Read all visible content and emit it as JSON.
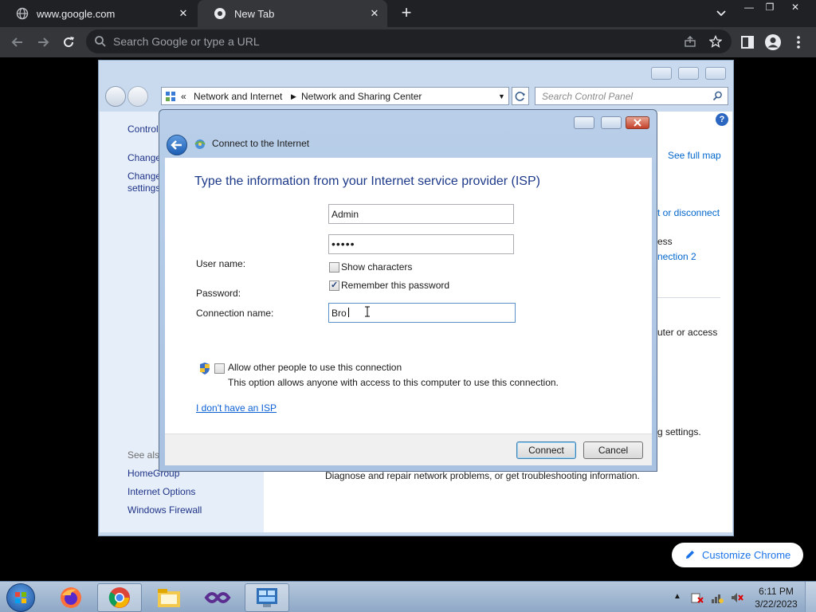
{
  "browser": {
    "tabs": [
      {
        "title": "www.google.com",
        "icon": "globe-icon"
      },
      {
        "title": "New Tab",
        "icon": "chrome-icon"
      }
    ],
    "omnibox_placeholder": "Search Google or type a URL"
  },
  "control_panel": {
    "breadcrumb": [
      "«",
      "Network and Internet",
      "Network and Sharing Center"
    ],
    "search_placeholder": "Search Control Panel",
    "left_links": [
      "Control",
      "Change",
      "Change",
      "settings"
    ],
    "see_also_title": "See also",
    "see_also": [
      "HomeGroup",
      "Internet Options",
      "Windows Firewall"
    ],
    "main_fragments": {
      "see_full_map": "See full map",
      "connect_disconnect": "t or disconnect",
      "access": "ess",
      "connection": "nection 2",
      "router_access": "uter or access",
      "settings": "g settings.",
      "diagnose": "Diagnose and repair network problems, or get troubleshooting information."
    }
  },
  "dialog": {
    "title": "Connect to the Internet",
    "heading": "Type the information from your Internet service provider (ISP)",
    "user_name_label": "User name:",
    "user_name_value": "Admin",
    "password_label": "Password:",
    "password_value": "•••••",
    "show_characters": {
      "label": "Show characters",
      "checked": false
    },
    "remember_password": {
      "label": "Remember this password",
      "checked": true
    },
    "connection_name_label": "Connection name:",
    "connection_name_value": "Bro",
    "allow_others": {
      "label": "Allow other people to use this connection",
      "checked": false
    },
    "allow_others_desc": "This option allows anyone with access to this computer to use this connection.",
    "no_isp_link": "I don't have an ISP",
    "connect_button": "Connect",
    "cancel_button": "Cancel"
  },
  "customize_chrome": "Customize Chrome",
  "taskbar": {
    "apps": [
      "firefox-icon",
      "chrome-icon",
      "file-explorer-icon",
      "visual-studio-icon",
      "control-panel-icon"
    ],
    "time": "6:11 PM",
    "date": "3/22/2023"
  }
}
